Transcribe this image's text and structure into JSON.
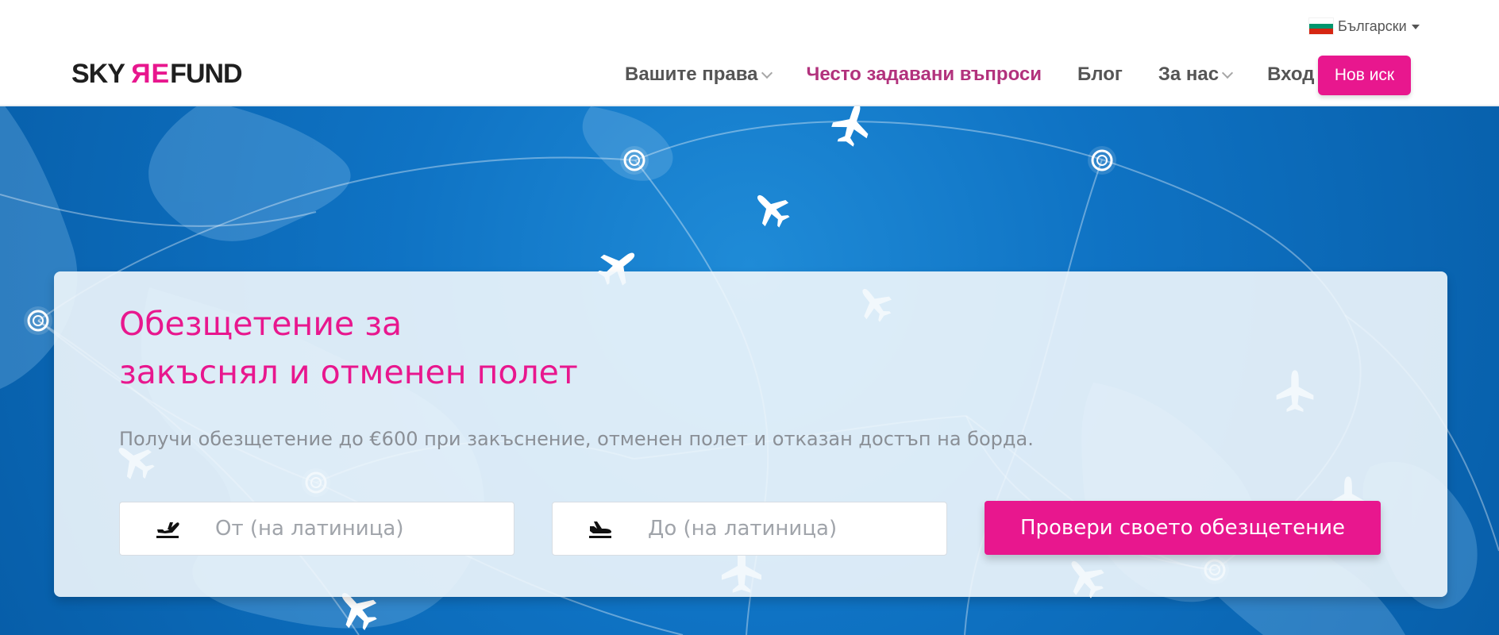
{
  "header": {
    "logo": {
      "sky": "SKY",
      "mirrored_r": "R",
      "mirrored_e": "E",
      "rest": "FUND"
    },
    "language": "Български",
    "nav": {
      "rights": "Вашите права",
      "faq": "Често задавани въпроси",
      "blog": "Блог",
      "about": "За нас",
      "login": "Вход",
      "new_claim": "Нов иск"
    },
    "colors": {
      "brand_pink": "#e8178e",
      "faq_pink": "#b2327d",
      "nav_text": "#555555"
    }
  },
  "hero": {
    "title_line_1": "Обезщетение за",
    "title_line_2": "закъснял и отменен полет",
    "subtitle": "Получи обезщетение до €600 при закъснение, отменен полет и отказан достъп на борда.",
    "from_placeholder": "От (на латиница)",
    "to_placeholder": "До (на латиница)",
    "check_button": "Провери своето обезщетение",
    "colors": {
      "background": "#0f73c4",
      "card": "#f1f7fc",
      "title": "#e8178e",
      "subtitle": "#8a8f96"
    }
  },
  "icons": {
    "flag": "bulgarian-flag-icon",
    "dropdown": "chevron-down-icon",
    "departure": "airplane-departure-icon",
    "arrival": "airplane-arrival-icon",
    "background_planes": "airplane-icon",
    "background_markers": "location-target-icon"
  }
}
